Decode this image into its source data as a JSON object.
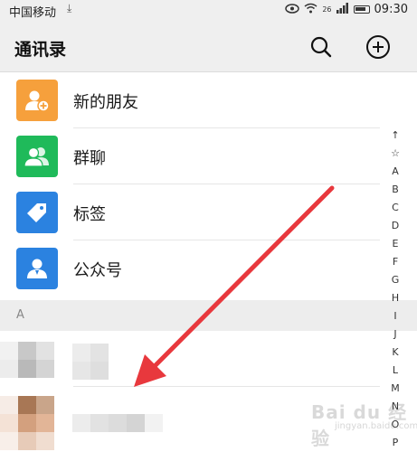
{
  "status_bar": {
    "carrier": "中国移动",
    "network": "26",
    "time": "09:30"
  },
  "header": {
    "title": "通讯录"
  },
  "menu": [
    {
      "label": "新的朋友",
      "icon": "add-friend-icon",
      "color": "#f6a03c"
    },
    {
      "label": "群聊",
      "icon": "group-chat-icon",
      "color": "#1fba5a"
    },
    {
      "label": "标签",
      "icon": "tag-icon",
      "color": "#2b82e0"
    },
    {
      "label": "公众号",
      "icon": "official-account-icon",
      "color": "#2b82e0"
    }
  ],
  "section": {
    "letter": "A"
  },
  "index_letters": [
    "↑",
    "☆",
    "A",
    "B",
    "C",
    "D",
    "E",
    "F",
    "G",
    "H",
    "I",
    "J",
    "K",
    "L",
    "M",
    "N",
    "O",
    "P"
  ],
  "annotation": {
    "arrow_color": "#e8383d"
  },
  "watermark": {
    "text": "Bai du 经验",
    "sub": "jingyan.baidu.com"
  }
}
